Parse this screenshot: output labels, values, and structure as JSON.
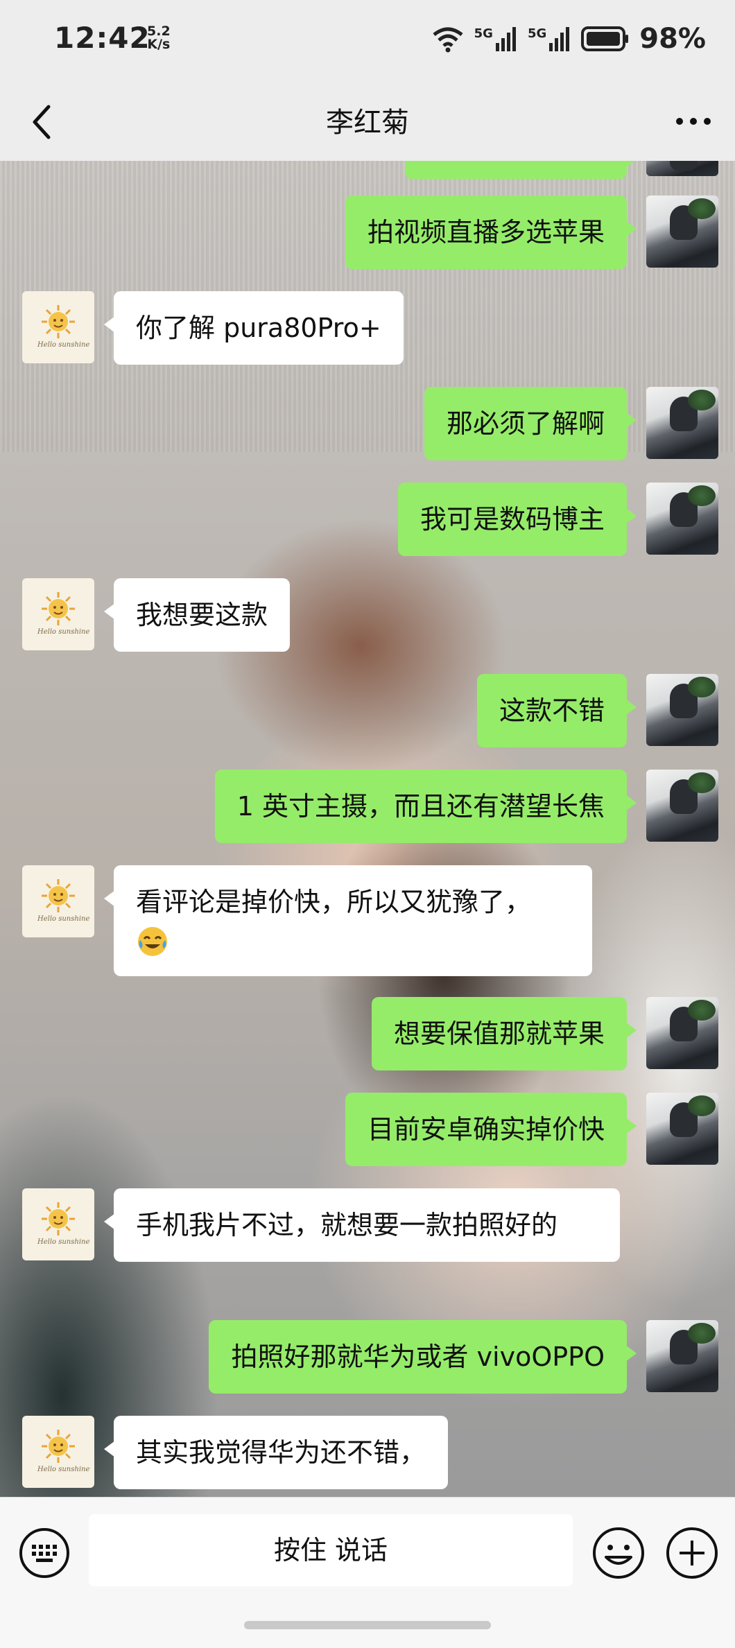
{
  "status_bar": {
    "time": "12:42",
    "speed_value": "5.2",
    "speed_unit": "K/s",
    "signal1": "5G",
    "signal2": "5G",
    "battery": "98%"
  },
  "header": {
    "title": "李红菊"
  },
  "messages": [
    {
      "sender": "self",
      "text": "拍视频直播多选苹果"
    },
    {
      "sender": "other",
      "text": "你了解 pura80Pro+"
    },
    {
      "sender": "self",
      "text": "那必须了解啊"
    },
    {
      "sender": "self",
      "text": "我可是数码博主"
    },
    {
      "sender": "other",
      "text": "我想要这款"
    },
    {
      "sender": "self",
      "text": "这款不错"
    },
    {
      "sender": "self",
      "text": "1 英寸主摄，而且还有潜望长焦"
    },
    {
      "sender": "other",
      "text": "看评论是掉价快，所以又犹豫了，"
    },
    {
      "sender": "self",
      "text": "想要保值那就苹果"
    },
    {
      "sender": "self",
      "text": "目前安卓确实掉价快"
    },
    {
      "sender": "other",
      "text": "手机我片不过，就想要一款拍照好的"
    },
    {
      "sender": "self",
      "text": "拍照好那就华为或者 vivoOPPO"
    },
    {
      "sender": "other",
      "text": "其实我觉得华为还不错，"
    }
  ],
  "input_bar": {
    "hold_to_talk": "按住 说话"
  },
  "colors": {
    "self_bubble": "#95ec69",
    "other_bubble": "#ffffff",
    "bar_bg": "#ededed"
  },
  "icons": [
    "back-icon",
    "more-icon",
    "keyboard-icon",
    "emoji-icon",
    "plus-icon",
    "wifi-icon",
    "signal-icon",
    "battery-icon"
  ]
}
